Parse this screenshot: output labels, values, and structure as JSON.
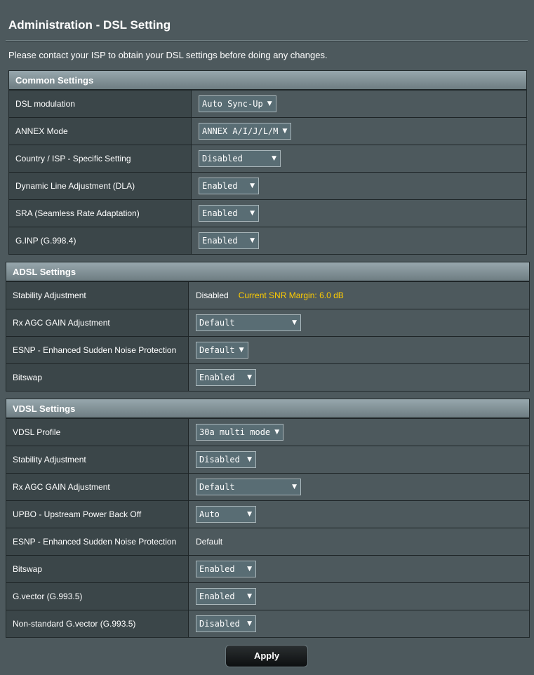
{
  "page": {
    "title": "Administration - DSL Setting",
    "notice": "Please contact your ISP to obtain your DSL settings before doing any changes."
  },
  "common": {
    "header": "Common Settings",
    "rows": [
      {
        "label": "DSL modulation",
        "value": "Auto Sync-Up"
      },
      {
        "label": "ANNEX Mode",
        "value": "ANNEX A/I/J/L/M"
      },
      {
        "label": "Country / ISP - Specific Setting",
        "value": "Disabled"
      },
      {
        "label": "Dynamic Line Adjustment (DLA)",
        "value": "Enabled"
      },
      {
        "label": "SRA (Seamless Rate Adaptation)",
        "value": "Enabled"
      },
      {
        "label": "G.INP (G.998.4)",
        "value": "Enabled"
      }
    ]
  },
  "adsl": {
    "header": "ADSL Settings",
    "rows": [
      {
        "label": "Stability Adjustment",
        "value": "Disabled",
        "note": "Current SNR Margin: 6.0 dB"
      },
      {
        "label": "Rx AGC GAIN Adjustment",
        "value": "Default"
      },
      {
        "label": "ESNP - Enhanced Sudden Noise Protection",
        "value": "Default"
      },
      {
        "label": "Bitswap",
        "value": "Enabled"
      }
    ]
  },
  "vdsl": {
    "header": "VDSL Settings",
    "rows": [
      {
        "label": "VDSL Profile",
        "value": "30a multi mode"
      },
      {
        "label": "Stability Adjustment",
        "value": "Disabled"
      },
      {
        "label": "Rx AGC GAIN Adjustment",
        "value": "Default"
      },
      {
        "label": "UPBO - Upstream Power Back Off",
        "value": "Auto"
      },
      {
        "label": "ESNP - Enhanced Sudden Noise Protection",
        "value": "Default"
      },
      {
        "label": "Bitswap",
        "value": "Enabled"
      },
      {
        "label": "G.vector (G.993.5)",
        "value": "Enabled"
      },
      {
        "label": "Non-standard G.vector (G.993.5)",
        "value": "Disabled"
      }
    ]
  },
  "actions": {
    "apply_label": "Apply"
  },
  "icons": {
    "dropdown": "caret-down-icon"
  },
  "colors": {
    "background": "#4d595d",
    "label_cell": "#3b4649",
    "select_bg": "#596d74",
    "snr_note": "#ffcc00"
  }
}
